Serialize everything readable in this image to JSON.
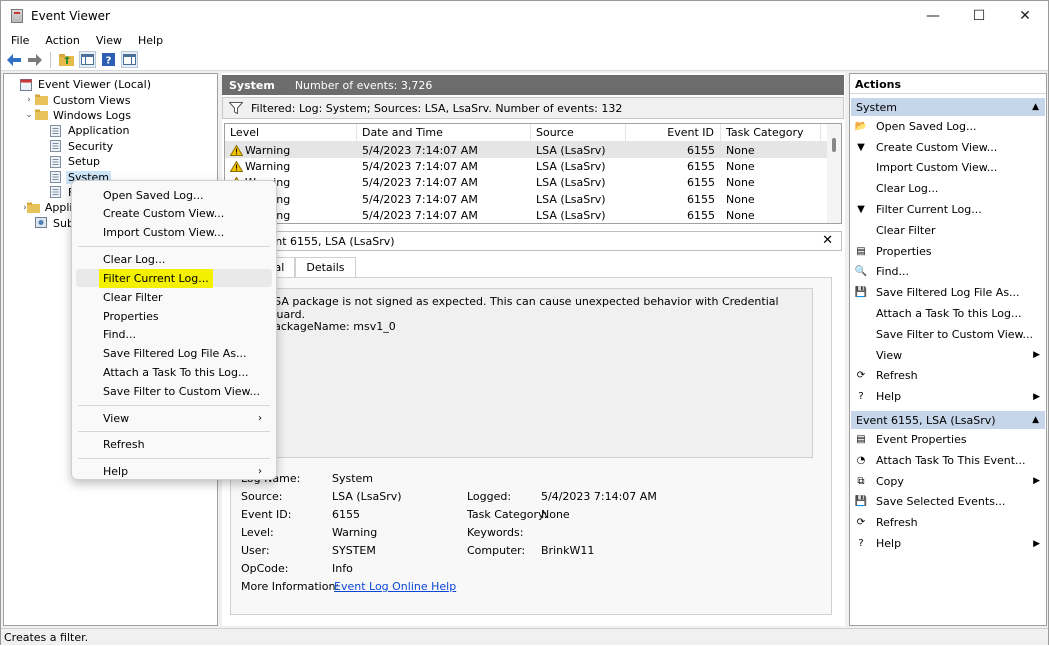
{
  "window": {
    "title": "Event Viewer",
    "controls": [
      "—",
      "☐",
      "✕"
    ]
  },
  "menubar": [
    "File",
    "Action",
    "View",
    "Help"
  ],
  "tree": [
    {
      "label": "Event Viewer (Local)",
      "indent": 0,
      "exp": "",
      "icon": "event-viewer"
    },
    {
      "label": "Custom Views",
      "indent": 1,
      "exp": "›",
      "icon": "folder"
    },
    {
      "label": "Windows Logs",
      "indent": 1,
      "exp": "⌄",
      "icon": "folder"
    },
    {
      "label": "Application",
      "indent": 2,
      "exp": "",
      "icon": "log"
    },
    {
      "label": "Security",
      "indent": 2,
      "exp": "",
      "icon": "log"
    },
    {
      "label": "Setup",
      "indent": 2,
      "exp": "",
      "icon": "log"
    },
    {
      "label": "System",
      "indent": 2,
      "exp": "",
      "icon": "log",
      "selected": true
    },
    {
      "label": "Forwarded Events",
      "indent": 2,
      "exp": "",
      "icon": "log"
    },
    {
      "label": "Applications and Services Logs",
      "indent": 1,
      "exp": "›",
      "icon": "folder"
    },
    {
      "label": "Subscriptions",
      "indent": 1,
      "exp": "",
      "icon": "subscription"
    }
  ],
  "center": {
    "log_name": "System",
    "event_count": "Number of events: 3,726",
    "filter_text": "Filtered: Log: System; Sources: LSA, LsaSrv. Number of events: 132",
    "columns": [
      "Level",
      "Date and Time",
      "Source",
      "Event ID",
      "Task Category"
    ],
    "rows": [
      {
        "level": "Warning",
        "date": "5/4/2023 7:14:07 AM",
        "source": "LSA (LsaSrv)",
        "id": "6155",
        "cat": "None"
      },
      {
        "level": "Warning",
        "date": "5/4/2023 7:14:07 AM",
        "source": "LSA (LsaSrv)",
        "id": "6155",
        "cat": "None"
      },
      {
        "level": "Warning",
        "date": "5/4/2023 7:14:07 AM",
        "source": "LSA (LsaSrv)",
        "id": "6155",
        "cat": "None"
      },
      {
        "level": "Warning",
        "date": "5/4/2023 7:14:07 AM",
        "source": "LSA (LsaSrv)",
        "id": "6155",
        "cat": "None"
      },
      {
        "level": "Warning",
        "date": "5/4/2023 7:14:07 AM",
        "source": "LSA (LsaSrv)",
        "id": "6155",
        "cat": "None"
      }
    ],
    "detail_title": "Event 6155, LSA (LsaSrv)",
    "tabs": [
      "General",
      "Details"
    ],
    "message": "LSA package is not signed as expected. This can cause unexpected behavior with Credential Guard.",
    "message2": "PackageName: msv1_0",
    "props": {
      "log_name_label": "Log Name:",
      "log_name": "System",
      "source_label": "Source:",
      "source": "LSA (LsaSrv)",
      "logged_label": "Logged:",
      "logged": "5/4/2023 7:14:07 AM",
      "event_id_label": "Event ID:",
      "event_id": "6155",
      "task_cat_label": "Task Category:",
      "task_cat": "None",
      "level_label": "Level:",
      "level": "Warning",
      "keywords_label": "Keywords:",
      "keywords": "",
      "user_label": "User:",
      "user": "SYSTEM",
      "computer_label": "Computer:",
      "computer": "BrinkW11",
      "opcode_label": "OpCode:",
      "opcode": "Info",
      "more_info_label": "More Information:",
      "more_info_link": "Event Log Online Help"
    },
    "close_glyph": "✕"
  },
  "actions": {
    "header": "Actions",
    "sections": [
      {
        "title": "System",
        "items": [
          {
            "label": "Open Saved Log...",
            "icon": "open-folder-icon",
            "glyph": "📂",
            "sub": false
          },
          {
            "label": "Create Custom View...",
            "icon": "filter-star-icon",
            "glyph": "▼",
            "sub": false
          },
          {
            "label": "Import Custom View...",
            "icon": "",
            "glyph": "",
            "sub": false
          },
          {
            "label": "Clear Log...",
            "icon": "",
            "glyph": "",
            "sub": false
          },
          {
            "label": "Filter Current Log...",
            "icon": "filter-icon",
            "glyph": "▼",
            "sub": false
          },
          {
            "label": "Clear Filter",
            "icon": "",
            "glyph": "",
            "sub": false
          },
          {
            "label": "Properties",
            "icon": "properties-icon",
            "glyph": "▤",
            "sub": false
          },
          {
            "label": "Find...",
            "icon": "find-icon",
            "glyph": "🔍",
            "sub": false
          },
          {
            "label": "Save Filtered Log File As...",
            "icon": "save-icon",
            "glyph": "💾",
            "sub": false
          },
          {
            "label": "Attach a Task To this Log...",
            "icon": "",
            "glyph": "",
            "sub": false
          },
          {
            "label": "Save Filter to Custom View...",
            "icon": "",
            "glyph": "",
            "sub": false
          },
          {
            "label": "View",
            "icon": "",
            "glyph": "",
            "sub": true
          },
          {
            "label": "Refresh",
            "icon": "refresh-icon",
            "glyph": "⟳",
            "sub": false
          },
          {
            "label": "Help",
            "icon": "help-icon",
            "glyph": "?",
            "sub": true
          }
        ]
      },
      {
        "title": "Event 6155, LSA (LsaSrv)",
        "items": [
          {
            "label": "Event Properties",
            "icon": "properties-icon",
            "glyph": "▤",
            "sub": false
          },
          {
            "label": "Attach Task To This Event...",
            "icon": "task-icon",
            "glyph": "◔",
            "sub": false
          },
          {
            "label": "Copy",
            "icon": "copy-icon",
            "glyph": "⧉",
            "sub": true
          },
          {
            "label": "Save Selected Events...",
            "icon": "save-icon",
            "glyph": "💾",
            "sub": false
          },
          {
            "label": "Refresh",
            "icon": "refresh-icon",
            "glyph": "⟳",
            "sub": false
          },
          {
            "label": "Help",
            "icon": "help-icon",
            "glyph": "?",
            "sub": true
          }
        ]
      }
    ]
  },
  "context_menu": {
    "items": [
      {
        "label": "Open Saved Log...",
        "sub": false
      },
      {
        "label": "Create Custom View...",
        "sub": false
      },
      {
        "label": "Import Custom View...",
        "sub": false
      },
      {
        "sep": true
      },
      {
        "label": "Clear Log...",
        "sub": false
      },
      {
        "label": "Filter Current Log...",
        "sub": false,
        "highlight": true
      },
      {
        "label": "Clear Filter",
        "sub": false
      },
      {
        "label": "Properties",
        "sub": false
      },
      {
        "label": "Find...",
        "sub": false
      },
      {
        "label": "Save Filtered Log File As...",
        "sub": false
      },
      {
        "label": "Attach a Task To this Log...",
        "sub": false
      },
      {
        "label": "Save Filter to Custom View...",
        "sub": false
      },
      {
        "sep": true
      },
      {
        "label": "View",
        "sub": true
      },
      {
        "sep": true
      },
      {
        "label": "Refresh",
        "sub": false
      },
      {
        "sep": true
      },
      {
        "label": "Help",
        "sub": true
      }
    ],
    "highlight_color": "#f3f000"
  },
  "statusbar": "Creates a filter.",
  "colors": {
    "section_header": "#c5d6ea",
    "center_header": "#6d6d6d",
    "link": "#0b47d6",
    "tree_selected": "#cce4f7"
  }
}
